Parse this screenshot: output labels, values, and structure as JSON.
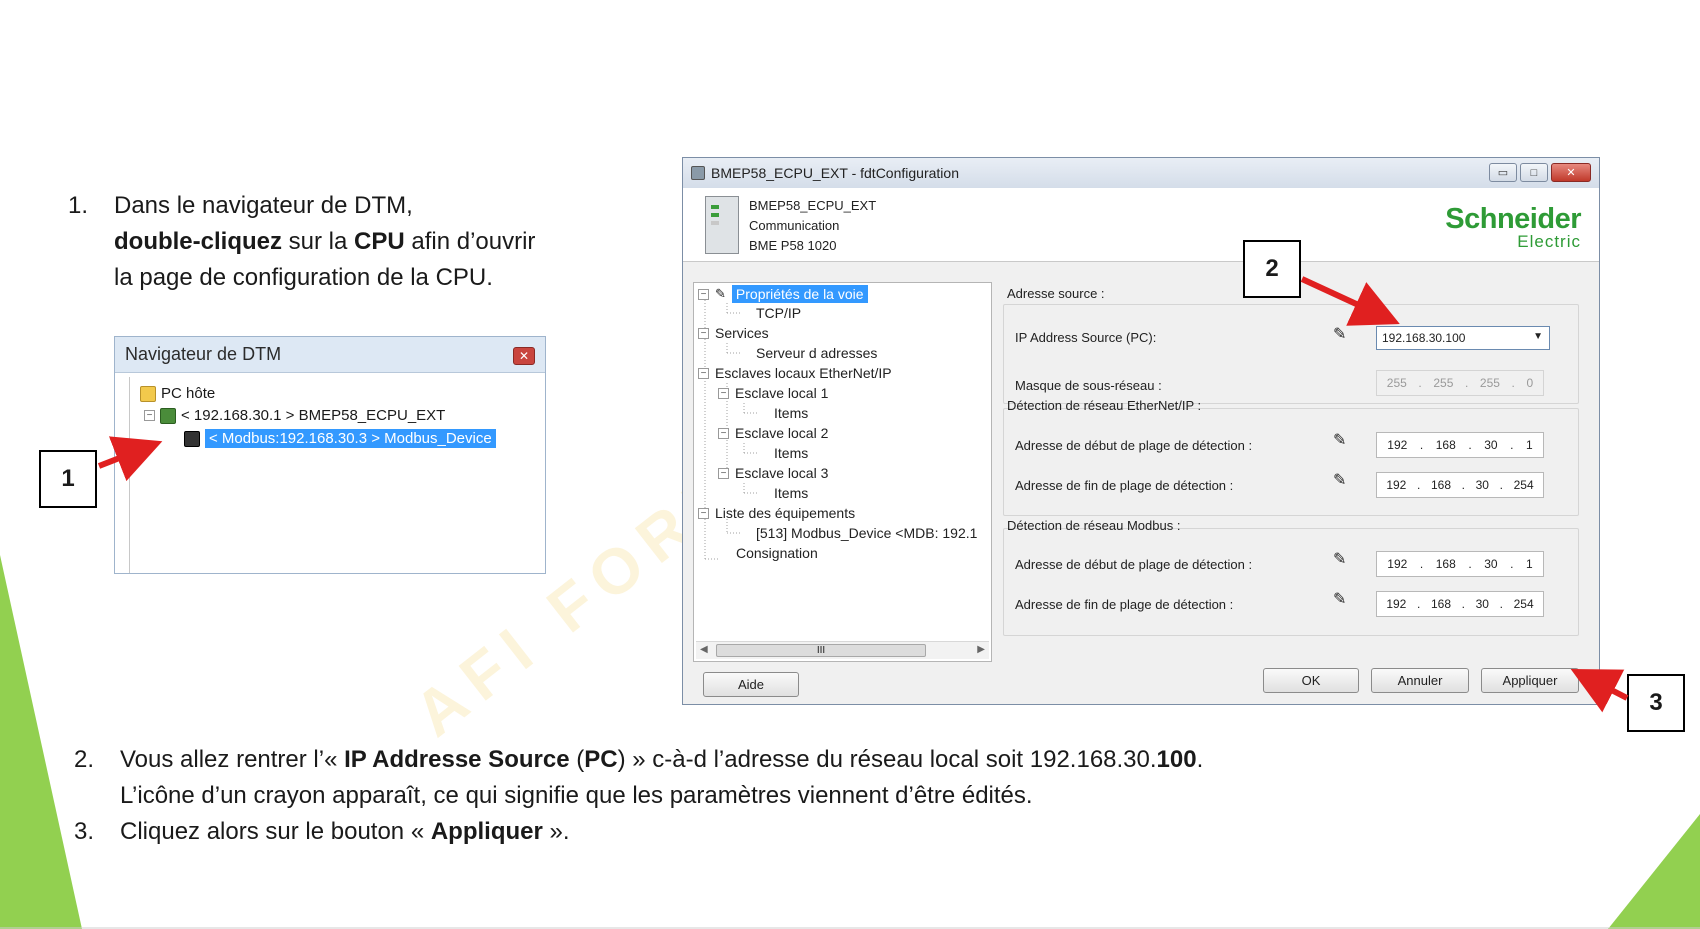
{
  "watermark": "AFI FORM",
  "instructions_top": {
    "step1": {
      "number": "1.",
      "line1": "Dans le navigateur de DTM,",
      "line2_bold": "double-cliquez",
      "line2_mid": " sur la ",
      "line2_cpu": "CPU",
      "line2_end": " afin d’ouvrir",
      "line3": "la page de configuration de la CPU."
    }
  },
  "instructions_bottom": {
    "step2": {
      "number": "2.",
      "a": "Vous allez rentrer l’« ",
      "b": "IP Addresse Source",
      "c": " (",
      "d": "PC",
      "e": ") » c-à-d l’adresse du réseau local soit 192.168.30.",
      "f": "100",
      "g": ".",
      "line2": "L’icône d’un crayon apparaît, ce qui signifie que les paramètres viennent d’être édités."
    },
    "step3": {
      "number": "3.",
      "a": "Cliquez alors sur le bouton « ",
      "b": "Appliquer",
      "c": " »."
    }
  },
  "callouts": [
    "1",
    "2",
    "3"
  ],
  "dtm_navigator": {
    "title": "Navigateur de DTM",
    "close_glyph": "✕",
    "nodes": {
      "host": "PC hôte",
      "cpu": "< 192.168.30.1 > BMEP58_ECPU_EXT",
      "device": "< Modbus:192.168.30.3 > Modbus_Device"
    }
  },
  "config_window": {
    "title": "BMEP58_ECPU_EXT - fdtConfiguration",
    "buttons": {
      "minimize": "▭",
      "maximize": "□",
      "close": "✕"
    },
    "device_lines": [
      "BMEP58_ECPU_EXT",
      "Communication",
      "BME P58 1020"
    ],
    "logo": {
      "line1": "Schneider",
      "line2": "Electric"
    },
    "tree": {
      "channel_props": "Propriétés de la voie",
      "tcpip": "TCP/IP",
      "services": "Services",
      "address_server": "Serveur d adresses",
      "local_slaves": "Esclaves locaux EtherNet/IP",
      "slave1": "Esclave local 1",
      "items1": "Items",
      "slave2": "Esclave local 2",
      "items2": "Items",
      "slave3": "Esclave local 3",
      "items3": "Items",
      "device_list": "Liste des équipements",
      "device_entry": "[513] Modbus_Device <MDB: 192.1",
      "logging": "Consignation"
    },
    "scroll_thumb": "III",
    "panel": {
      "source_label": "Adresse source :",
      "ip_source_label": "IP Address Source (PC):",
      "ip_source_value": "192.168.30.100",
      "subnet_label": "Masque de sous-réseau :",
      "subnet": [
        "255",
        "255",
        "255",
        "0"
      ],
      "eip_label": "Détection de réseau EtherNet/IP :",
      "eip_start_label": "Adresse de début de plage de détection :",
      "eip_start": [
        "192",
        "168",
        "30",
        "1"
      ],
      "eip_end_label": "Adresse de fin de plage de détection :",
      "eip_end": [
        "192",
        "168",
        "30",
        "254"
      ],
      "modbus_label": "Détection de réseau Modbus :",
      "mb_start_label": "Adresse de début de plage de détection :",
      "mb_start": [
        "192",
        "168",
        "30",
        "1"
      ],
      "mb_end_label": "Adresse de fin de plage de détection :",
      "mb_end": [
        "192",
        "168",
        "30",
        "254"
      ],
      "pencil_glyph": "✎",
      "dot": "."
    },
    "footer": {
      "help": "Aide",
      "ok": "OK",
      "cancel": "Annuler",
      "apply": "Appliquer"
    }
  },
  "colors": {
    "accent_green": "#92d050",
    "arrow_red": "#e02020",
    "selection": "#3399ff",
    "logo_green": "#2e9b36"
  }
}
